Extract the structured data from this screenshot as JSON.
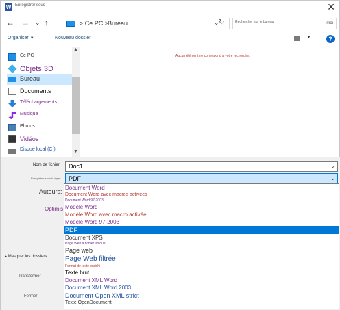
{
  "window": {
    "title": "Enregistrer sous",
    "app_icon": "W"
  },
  "nav": {
    "back": "←",
    "forward": "→",
    "dropdown": "⌄",
    "up": "↑",
    "breadcrumbs": [
      "> Ce PC >",
      "Bureau"
    ],
    "address_dropdown": "⌄",
    "refresh": "↻",
    "search_placeholder": "Rechercher sur le bureau",
    "search_icon_text": "moi"
  },
  "toolbar": {
    "organize": "Organiser",
    "new_folder": "Nouveau dossier",
    "help": "?"
  },
  "tree": [
    {
      "label": "Ce PC",
      "icon": "computer-icon",
      "size": "s",
      "color": "#333333"
    },
    {
      "label": "Objets 3D",
      "icon": "cube-3d-icon",
      "size": "l",
      "color": "#7b2e8c"
    },
    {
      "label": "Bureau",
      "icon": "desktop-icon",
      "size": "m",
      "color": "#333333",
      "selected": true
    },
    {
      "label": "Documents",
      "icon": "documents-icon",
      "size": "m",
      "color": "#111111"
    },
    {
      "label": "Téléchargements",
      "icon": "download-icon",
      "size": "s",
      "color": "#7b2e8c"
    },
    {
      "label": "Musique",
      "icon": "music-icon",
      "size": "s",
      "color": "#7b2e8c"
    },
    {
      "label": "Photos",
      "icon": "photos-icon",
      "size": "s",
      "color": "#333333"
    },
    {
      "label": "Vidéos",
      "icon": "video-icon",
      "size": "m",
      "color": "#7b2e8c"
    },
    {
      "label": "Disque local (C:)",
      "icon": "drive-icon",
      "size": "s",
      "color": "#1f4e9c"
    }
  ],
  "content": {
    "empty_message": "Aucun élément ne correspond à votre recherche."
  },
  "form": {
    "filename_label": "Nom de fichier:",
    "filename_value": "Doc1",
    "type_label": "Enregistrer sous le type :",
    "type_value": "PDF",
    "authors_label": "Auteurs:",
    "optimize_label": "Optimis",
    "hide_folders": "Masquer les dossiers",
    "transform": "Transformer",
    "close": "Fermer"
  },
  "file_types": [
    {
      "label": "Document Word",
      "color": "#7b2e8c",
      "size": 8
    },
    {
      "label": "Document Word avec macros activées",
      "color": "#b5382c",
      "size": 7
    },
    {
      "label": "Document Word 97-2003",
      "color": "#7b2e8c",
      "size": 5
    },
    {
      "label": "Modèle Word",
      "color": "#7b2e8c",
      "size": 8
    },
    {
      "label": "Modèle Word avec macro activée",
      "color": "#b5382c",
      "size": 8
    },
    {
      "label": "Modèle Word 97-2003",
      "color": "#7b2e8c",
      "size": 8
    },
    {
      "label": "PDF",
      "color": "#ffffff",
      "size": 9,
      "selected": true
    },
    {
      "label": "Document XPS",
      "color": "#333333",
      "size": 8
    },
    {
      "label": "Page Web à fichier unique",
      "color": "#7b2e8c",
      "size": 5
    },
    {
      "label": "Page web",
      "color": "#333333",
      "size": 9
    },
    {
      "label": "Page Web filtrée",
      "color": "#1f4e9c",
      "size": 10
    },
    {
      "label": "Format de texte enrichi",
      "color": "#b5382c",
      "size": 5
    },
    {
      "label": "Texte brut",
      "color": "#111111",
      "size": 8
    },
    {
      "label": "Document XML Word",
      "color": "#7b2e8c",
      "size": 8
    },
    {
      "label": "Document XML Word 2003",
      "color": "#1f4e9c",
      "size": 8
    },
    {
      "label": "Document Open XML strict",
      "color": "#1f4e9c",
      "size": 9
    },
    {
      "label": "Texte OpenDocument",
      "color": "#333333",
      "size": 7
    }
  ]
}
